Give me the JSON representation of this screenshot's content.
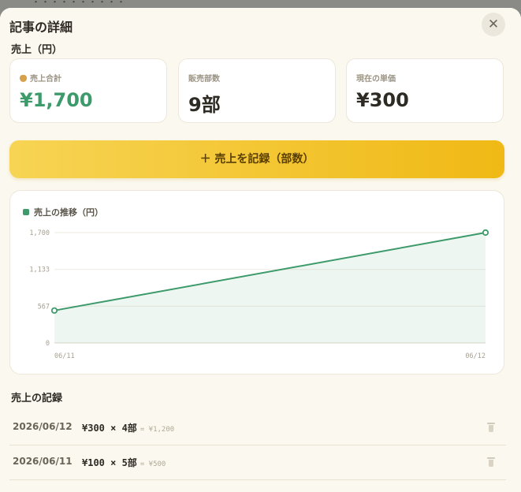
{
  "modal": {
    "title": "記事の詳細",
    "close_glyph": "✕",
    "partial_heading": "売上（円）"
  },
  "stats": [
    {
      "label": "売上合計",
      "value": "¥1,700",
      "accent": "#3d9a6a"
    },
    {
      "label": "販売部数",
      "value": "9部"
    },
    {
      "label": "現在の単価",
      "value": "¥300"
    }
  ],
  "record_button": {
    "label": "＋ 売上を記録（部数）"
  },
  "chart_data": {
    "type": "area",
    "title": "売上の推移（円）",
    "x": [
      "06/11",
      "06/12"
    ],
    "series": [
      {
        "values": [
          500,
          1700
        ],
        "color": "#3d9a6a"
      }
    ],
    "y_ticks": [
      "0",
      "567",
      "1,133",
      "1,700"
    ],
    "ylim": [
      0,
      1700
    ],
    "grid": true
  },
  "records": {
    "title": "売上の記録",
    "rows": [
      {
        "date": "2026/06/12",
        "calc": "¥300 × 4部",
        "total": "= ¥1,200"
      },
      {
        "date": "2026/06/11",
        "calc": "¥100 × 5部",
        "total": "= ¥500"
      }
    ]
  }
}
